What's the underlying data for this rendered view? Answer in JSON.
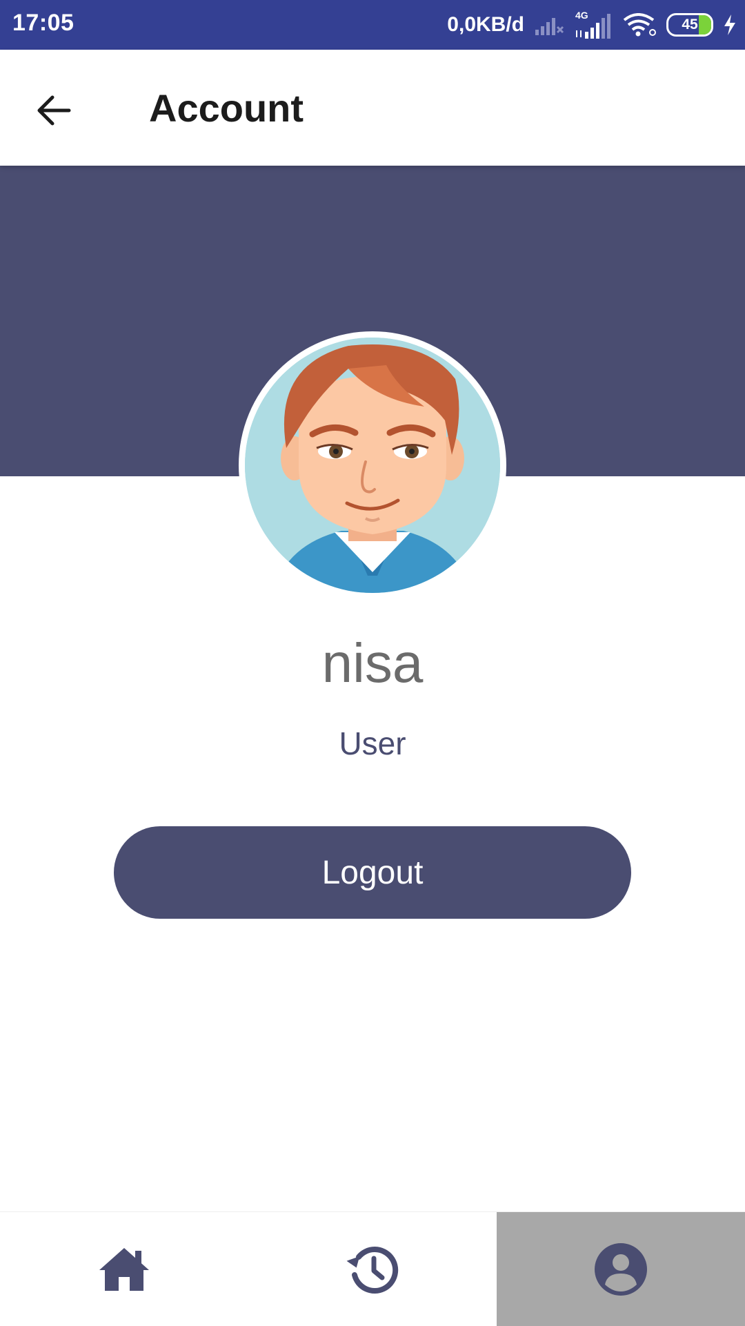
{
  "status_bar": {
    "time": "17:05",
    "net_speed": "0,0KB/d",
    "network_type": "4G",
    "battery_level": "45",
    "icons": [
      "signal-x-icon",
      "signal-icon",
      "wifi-icon",
      "battery-icon",
      "charging-icon"
    ]
  },
  "app_bar": {
    "title": "Account",
    "back_icon": "arrow-left-icon"
  },
  "profile": {
    "username": "nisa",
    "role": "User",
    "avatar_icon": "cartoon-man-avatar"
  },
  "actions": {
    "logout_label": "Logout"
  },
  "bottom_nav": {
    "items": [
      {
        "icon": "home-icon",
        "active": false
      },
      {
        "icon": "history-icon",
        "active": false
      },
      {
        "icon": "account-icon",
        "active": true
      }
    ]
  },
  "colors": {
    "status_bar": "#344093",
    "primary": "#4a4d71",
    "active_tab": "#a8a8a8"
  }
}
